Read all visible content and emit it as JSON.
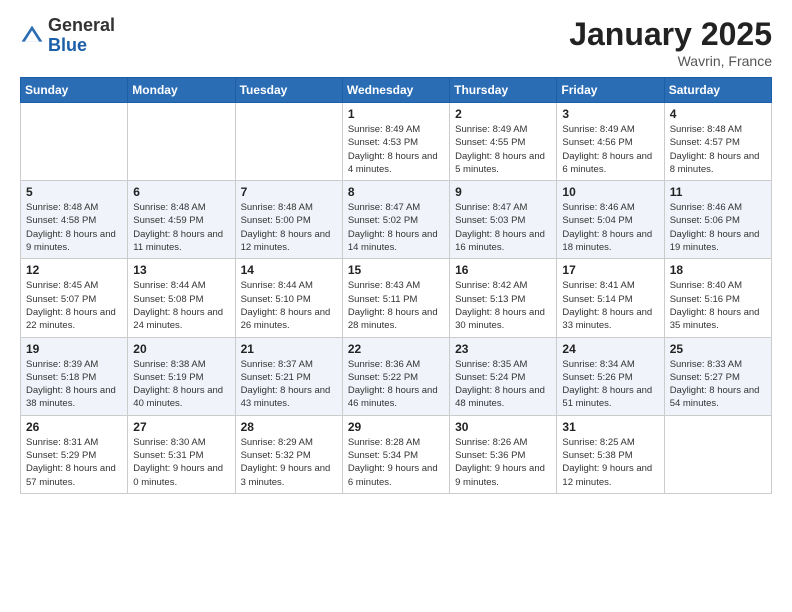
{
  "header": {
    "logo_general": "General",
    "logo_blue": "Blue",
    "title": "January 2025",
    "location": "Wavrin, France"
  },
  "weekdays": [
    "Sunday",
    "Monday",
    "Tuesday",
    "Wednesday",
    "Thursday",
    "Friday",
    "Saturday"
  ],
  "weeks": [
    [
      {
        "day": "",
        "info": ""
      },
      {
        "day": "",
        "info": ""
      },
      {
        "day": "",
        "info": ""
      },
      {
        "day": "1",
        "info": "Sunrise: 8:49 AM\nSunset: 4:53 PM\nDaylight: 8 hours\nand 4 minutes."
      },
      {
        "day": "2",
        "info": "Sunrise: 8:49 AM\nSunset: 4:55 PM\nDaylight: 8 hours\nand 5 minutes."
      },
      {
        "day": "3",
        "info": "Sunrise: 8:49 AM\nSunset: 4:56 PM\nDaylight: 8 hours\nand 6 minutes."
      },
      {
        "day": "4",
        "info": "Sunrise: 8:48 AM\nSunset: 4:57 PM\nDaylight: 8 hours\nand 8 minutes."
      }
    ],
    [
      {
        "day": "5",
        "info": "Sunrise: 8:48 AM\nSunset: 4:58 PM\nDaylight: 8 hours\nand 9 minutes."
      },
      {
        "day": "6",
        "info": "Sunrise: 8:48 AM\nSunset: 4:59 PM\nDaylight: 8 hours\nand 11 minutes."
      },
      {
        "day": "7",
        "info": "Sunrise: 8:48 AM\nSunset: 5:00 PM\nDaylight: 8 hours\nand 12 minutes."
      },
      {
        "day": "8",
        "info": "Sunrise: 8:47 AM\nSunset: 5:02 PM\nDaylight: 8 hours\nand 14 minutes."
      },
      {
        "day": "9",
        "info": "Sunrise: 8:47 AM\nSunset: 5:03 PM\nDaylight: 8 hours\nand 16 minutes."
      },
      {
        "day": "10",
        "info": "Sunrise: 8:46 AM\nSunset: 5:04 PM\nDaylight: 8 hours\nand 18 minutes."
      },
      {
        "day": "11",
        "info": "Sunrise: 8:46 AM\nSunset: 5:06 PM\nDaylight: 8 hours\nand 19 minutes."
      }
    ],
    [
      {
        "day": "12",
        "info": "Sunrise: 8:45 AM\nSunset: 5:07 PM\nDaylight: 8 hours\nand 22 minutes."
      },
      {
        "day": "13",
        "info": "Sunrise: 8:44 AM\nSunset: 5:08 PM\nDaylight: 8 hours\nand 24 minutes."
      },
      {
        "day": "14",
        "info": "Sunrise: 8:44 AM\nSunset: 5:10 PM\nDaylight: 8 hours\nand 26 minutes."
      },
      {
        "day": "15",
        "info": "Sunrise: 8:43 AM\nSunset: 5:11 PM\nDaylight: 8 hours\nand 28 minutes."
      },
      {
        "day": "16",
        "info": "Sunrise: 8:42 AM\nSunset: 5:13 PM\nDaylight: 8 hours\nand 30 minutes."
      },
      {
        "day": "17",
        "info": "Sunrise: 8:41 AM\nSunset: 5:14 PM\nDaylight: 8 hours\nand 33 minutes."
      },
      {
        "day": "18",
        "info": "Sunrise: 8:40 AM\nSunset: 5:16 PM\nDaylight: 8 hours\nand 35 minutes."
      }
    ],
    [
      {
        "day": "19",
        "info": "Sunrise: 8:39 AM\nSunset: 5:18 PM\nDaylight: 8 hours\nand 38 minutes."
      },
      {
        "day": "20",
        "info": "Sunrise: 8:38 AM\nSunset: 5:19 PM\nDaylight: 8 hours\nand 40 minutes."
      },
      {
        "day": "21",
        "info": "Sunrise: 8:37 AM\nSunset: 5:21 PM\nDaylight: 8 hours\nand 43 minutes."
      },
      {
        "day": "22",
        "info": "Sunrise: 8:36 AM\nSunset: 5:22 PM\nDaylight: 8 hours\nand 46 minutes."
      },
      {
        "day": "23",
        "info": "Sunrise: 8:35 AM\nSunset: 5:24 PM\nDaylight: 8 hours\nand 48 minutes."
      },
      {
        "day": "24",
        "info": "Sunrise: 8:34 AM\nSunset: 5:26 PM\nDaylight: 8 hours\nand 51 minutes."
      },
      {
        "day": "25",
        "info": "Sunrise: 8:33 AM\nSunset: 5:27 PM\nDaylight: 8 hours\nand 54 minutes."
      }
    ],
    [
      {
        "day": "26",
        "info": "Sunrise: 8:31 AM\nSunset: 5:29 PM\nDaylight: 8 hours\nand 57 minutes."
      },
      {
        "day": "27",
        "info": "Sunrise: 8:30 AM\nSunset: 5:31 PM\nDaylight: 9 hours\nand 0 minutes."
      },
      {
        "day": "28",
        "info": "Sunrise: 8:29 AM\nSunset: 5:32 PM\nDaylight: 9 hours\nand 3 minutes."
      },
      {
        "day": "29",
        "info": "Sunrise: 8:28 AM\nSunset: 5:34 PM\nDaylight: 9 hours\nand 6 minutes."
      },
      {
        "day": "30",
        "info": "Sunrise: 8:26 AM\nSunset: 5:36 PM\nDaylight: 9 hours\nand 9 minutes."
      },
      {
        "day": "31",
        "info": "Sunrise: 8:25 AM\nSunset: 5:38 PM\nDaylight: 9 hours\nand 12 minutes."
      },
      {
        "day": "",
        "info": ""
      }
    ]
  ]
}
